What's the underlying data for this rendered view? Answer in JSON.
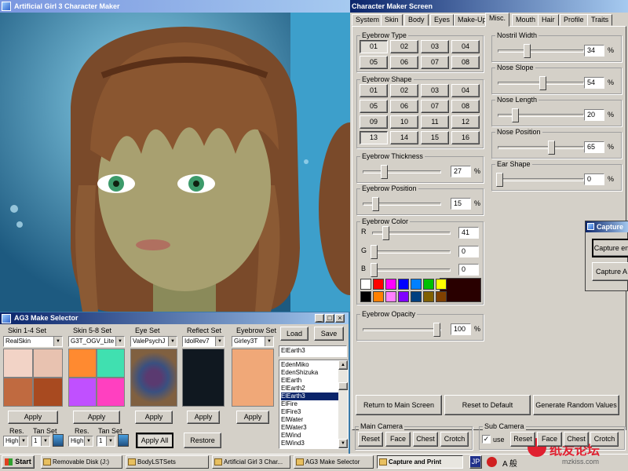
{
  "viewer": {
    "title": "Artificial Girl 3 Character Maker"
  },
  "maker": {
    "title": "Character Maker Screen",
    "tabs": [
      "System",
      "Skin",
      "Body",
      "Eyes",
      "Make-Up",
      "Misc.",
      "Mouth",
      "Hair",
      "Profile",
      "Traits"
    ],
    "active_tab": "Misc.",
    "eyebrow_type": {
      "label": "Eyebrow Type",
      "options": [
        "01",
        "02",
        "03",
        "04",
        "05",
        "06",
        "07",
        "08"
      ],
      "selected": "01"
    },
    "eyebrow_shape": {
      "label": "Eyebrow Shape",
      "options": [
        "01",
        "02",
        "03",
        "04",
        "05",
        "06",
        "07",
        "08",
        "09",
        "10",
        "11",
        "12",
        "13",
        "14",
        "15",
        "16"
      ],
      "selected": "13"
    },
    "eyebrow_thickness": {
      "label": "Eyebrow Thickness",
      "value": "27",
      "unit": "%",
      "fraction": 0.27
    },
    "eyebrow_position": {
      "label": "Eyebrow Position",
      "value": "15",
      "unit": "%",
      "fraction": 0.15
    },
    "eyebrow_color": {
      "label": "Eyebrow Color",
      "r_label": "R",
      "g_label": "G",
      "b_label": "B",
      "r": "41",
      "g": "0",
      "b": "0",
      "r_fraction": 0.16,
      "g_fraction": 0,
      "b_fraction": 0,
      "palette": [
        "#ffffff",
        "#ff0000",
        "#ff00ff",
        "#0000ff",
        "#0080ff",
        "#00c000",
        "#ffff00",
        "#000000",
        "#ff8000",
        "#ff80ff",
        "#8000ff",
        "#004080",
        "#806000",
        "#804000"
      ],
      "preview": "#290000"
    },
    "eyebrow_opacity": {
      "label": "Eyebrow Opacity",
      "value": "100",
      "unit": "%",
      "fraction": 1.0
    },
    "nostril_width": {
      "label": "Nostril Width",
      "value": "34",
      "unit": "%",
      "fraction": 0.34
    },
    "nose_slope": {
      "label": "Nose Slope",
      "value": "54",
      "unit": "%",
      "fraction": 0.54
    },
    "nose_length": {
      "label": "Nose Length",
      "value": "20",
      "unit": "%",
      "fraction": 0.2
    },
    "nose_position": {
      "label": "Nose Position",
      "value": "65",
      "unit": "%",
      "fraction": 0.65
    },
    "ear_shape": {
      "label": "Ear Shape",
      "value": "0",
      "unit": "%",
      "fraction": 0
    },
    "buttons": {
      "main": "Return to Main Screen",
      "reset": "Reset to Default",
      "random": "Generate Random Values"
    },
    "main_camera": {
      "label": "Main Camera",
      "buttons": [
        "Reset",
        "Face",
        "Chest",
        "Crotch"
      ]
    },
    "sub_camera": {
      "label": "Sub Camera",
      "use": "use",
      "buttons": [
        "Reset",
        "Face",
        "Chest",
        "Crotch"
      ]
    }
  },
  "capture": {
    "title": "Capture",
    "buttons": [
      "Capture en",
      "Capture A"
    ]
  },
  "selector": {
    "title": "AG3 Make Selector",
    "columns": [
      {
        "label": "Skin 1-4 Set",
        "value": "RealSkin"
      },
      {
        "label": "Skin 5-8 Set",
        "value": "G3T_OGV_Lite"
      },
      {
        "label": "Eye Set",
        "value": "ValePsychJ"
      },
      {
        "label": "Reflect Set",
        "value": "IdolRev7"
      },
      {
        "label": "Eyebrow Set",
        "value": "Girley3T"
      }
    ],
    "apply": "Apply",
    "apply_all": "Apply All",
    "restore": "Restore",
    "load": "Load",
    "save": "Save",
    "res_label": "Res.",
    "tan_label": "Tan Set",
    "res_value": "High",
    "tan_value": "1",
    "list_input": "ElEarth3",
    "list_items": [
      "EdenMiko",
      "EdenShizuka",
      "ElEarth",
      "ElEarth2",
      "ElEarth3",
      "ElFire",
      "ElFire3",
      "ElWater",
      "ElWater3",
      "ElWind",
      "ElWind3"
    ],
    "list_selected": "ElEarth3",
    "skin_colors_a": [
      "#f2d3c6",
      "#e8c2b0",
      "#c06a40",
      "#a84a20"
    ],
    "skin_colors_b": [
      "#ff8a30",
      "#40e0b0",
      "#c050ff",
      "#ff40c0"
    ]
  },
  "taskbar": {
    "start": "Start",
    "items": [
      "Removable Disk (J:)",
      "BodyLSTSets",
      "Artificial Girl 3 Char...",
      "AG3 Make Selector",
      "Capture and Print"
    ],
    "active": "Capture and Print",
    "tray": [
      "JP",
      "A 般"
    ],
    "watermark": "纸友论坛",
    "watermark_url": "mzkiss.com"
  }
}
